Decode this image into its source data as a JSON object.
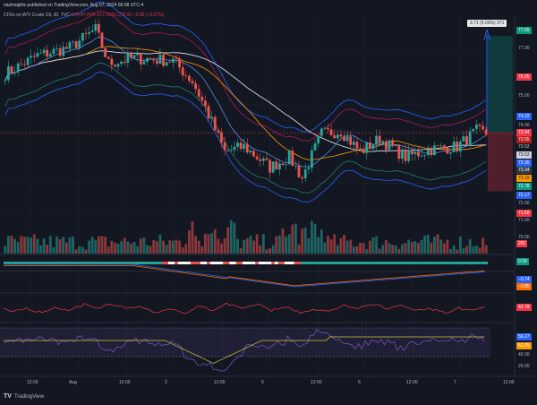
{
  "header": {
    "publisher": "riazinsights published on TradingView.com, Aug 07, 2024 06:08 UTC-4",
    "symbol": "CFDs on WTI Crude Oil, 30, TVC",
    "ohlc": {
      "o_label": "O",
      "o": "73.47",
      "h_label": "H",
      "h": "74.10",
      "l_label": "L",
      "l": "73.91",
      "c_label": "C",
      "c": "73.92",
      "chg": "−0.05 (−0.07%)"
    }
  },
  "projection_label": "3.71 (5.03%) 371",
  "price_labels": [
    {
      "value": "77.65",
      "color": "#089981",
      "text": "#ffffff"
    },
    {
      "value": "77.00",
      "color": "#131722",
      "text": "#b2b5be"
    },
    {
      "value": "76.05",
      "color": "#f23645",
      "text": "#ffffff"
    },
    {
      "value": "75.00",
      "color": "#131722",
      "text": "#b2b5be"
    },
    {
      "value": "74.22",
      "color": "#2962ff",
      "text": "#ffffff"
    },
    {
      "value": "74.00",
      "color": "#131722",
      "text": "#b2b5be"
    },
    {
      "value": "73.94",
      "color": "#f23645",
      "text": "#ffffff"
    },
    {
      "value": "73.55",
      "color": "#b71c1c",
      "text": "#ffffff"
    },
    {
      "value": "73.52",
      "color": "#131722",
      "text": "#d1d4dc"
    },
    {
      "value": "73.53",
      "color": "#d1d4dc",
      "text": "#131722"
    },
    {
      "value": "73.35",
      "color": "#2962ff",
      "text": "#ffffff"
    },
    {
      "value": "73.34",
      "color": "#363a45",
      "text": "#ffffff"
    },
    {
      "value": "73.19",
      "color": "#ff9800",
      "text": "#131722"
    },
    {
      "value": "72.78",
      "color": "#089981",
      "text": "#ffffff"
    },
    {
      "value": "72.17",
      "color": "#2962ff",
      "text": "#ffffff"
    },
    {
      "value": "72.00",
      "color": "#131722",
      "text": "#b2b5be"
    },
    {
      "value": "71.68",
      "color": "#f23645",
      "text": "#ffffff"
    },
    {
      "value": "71.00",
      "color": "#131722",
      "text": "#b2b5be"
    }
  ],
  "volume_label": {
    "value": "281",
    "color": "#f23645"
  },
  "osc1_labels": [
    {
      "value": "0.09",
      "color": "#089981"
    }
  ],
  "osc2_labels": [
    {
      "value": "−0.74",
      "color": "#2962ff"
    },
    {
      "value": "−0.85",
      "color": "#ff6d00"
    }
  ],
  "osc3_labels": [
    {
      "value": "43.78",
      "color": "#f23645"
    }
  ],
  "rsi_labels": [
    {
      "value": "56.27",
      "color": "#2962ff"
    },
    {
      "value": "52.25",
      "color": "#ff9800"
    },
    {
      "value": "40.00",
      "color": "#131722"
    },
    {
      "value": "20.00",
      "color": "#131722"
    }
  ],
  "time_axis": [
    "12:00",
    "Aug",
    "12:00",
    "2",
    "12:00",
    "5",
    "12:00",
    "6",
    "12:00",
    "7",
    "12:00"
  ],
  "price_axis_extra": [
    "70.00"
  ],
  "logo_text": "TradingView",
  "colors": {
    "bg": "#131722",
    "up": "#26a69a",
    "down": "#ef5350",
    "grid": "#1e222d"
  }
}
